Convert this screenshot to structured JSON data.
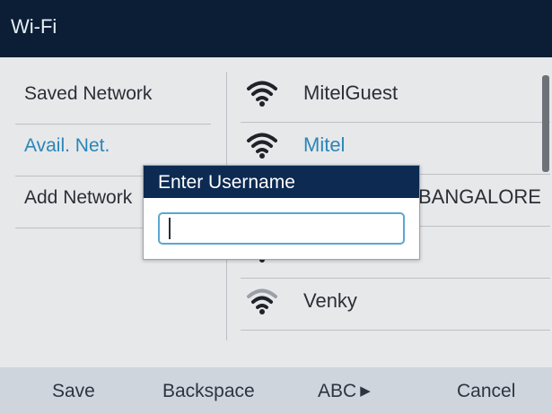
{
  "title_bar": {
    "title": "Wi-Fi"
  },
  "menu": {
    "items": [
      {
        "label": "Saved Network",
        "active": false
      },
      {
        "label": "Avail. Net.",
        "active": true
      },
      {
        "label": "Add Network",
        "active": false
      }
    ]
  },
  "networks": [
    {
      "name": "MitelGuest",
      "selected": false
    },
    {
      "name": "Mitel",
      "selected": true
    },
    {
      "name": "BANGALORE",
      "selected": false
    },
    {
      "name": "",
      "selected": false
    },
    {
      "name": "Venky",
      "selected": false
    }
  ],
  "dialog": {
    "title": "Enter Username",
    "input_value": ""
  },
  "softkeys": {
    "save": "Save",
    "backspace": "Backspace",
    "abc": "ABC",
    "abc_arrow": "▶",
    "cancel": "Cancel"
  },
  "icons": {
    "wifi": "wifi-icon",
    "arrow": "triangle-right-icon"
  },
  "colors": {
    "title_bar": "#0c1e35",
    "dialog_header": "#0c2a52",
    "accent": "#2a86b8",
    "softkey_bar": "#cfd5dc",
    "content_bg": "#e7e8ea"
  }
}
